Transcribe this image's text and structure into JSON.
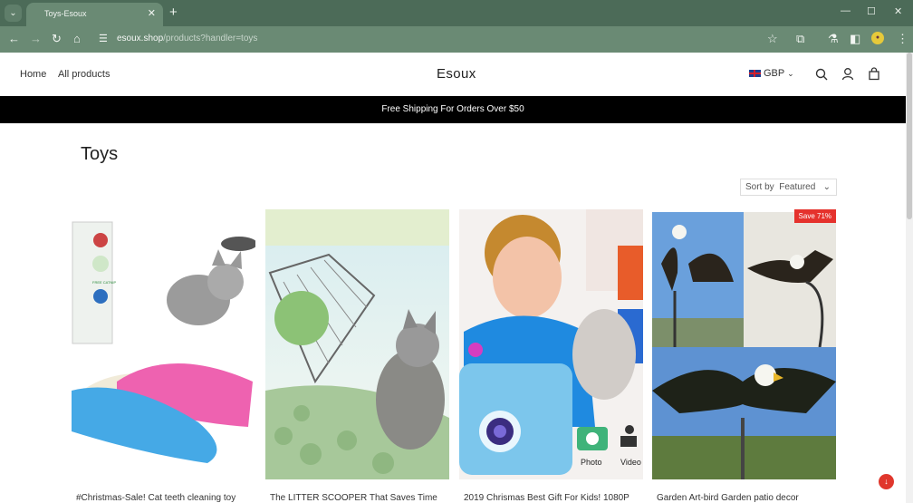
{
  "browser": {
    "tab_title": "Toys-Esoux",
    "url_host": "esoux.shop",
    "url_path": "/products?handler=toys"
  },
  "header": {
    "nav": [
      "Home",
      "All products"
    ],
    "logo": "Esoux",
    "currency": "GBP"
  },
  "announcement": "Free Shipping For Orders Over $50",
  "collection": {
    "title": "Toys",
    "sort_label": "Sort by",
    "sort_value": "Featured"
  },
  "products": [
    {
      "title": "#Christmas-Sale! Cat teeth cleaning toy"
    },
    {
      "title": "The LITTER SCOOPER That Saves Time"
    },
    {
      "title": "2019 Chrismas Best Gift For Kids! 1080P"
    },
    {
      "title": "Garden Art-bird Garden patio decor",
      "badge": "Save 71%"
    }
  ],
  "camera_card": {
    "photo_label": "Photo",
    "video_label": "Video"
  },
  "cat_package_text": "FREE CATNIP",
  "icons": [
    "tab-dropdown-icon",
    "new-tab-icon",
    "minimize-icon",
    "maximize-icon",
    "window-close-icon",
    "back-icon",
    "forward-icon",
    "reload-icon",
    "home-icon",
    "site-info-icon",
    "bookmark-star-icon",
    "extensions-icon",
    "labs-icon",
    "sidebar-icon",
    "profile-icon",
    "more-icon",
    "search-icon",
    "account-icon",
    "cart-icon",
    "chevron-down-icon",
    "chat-icon"
  ],
  "colors": {
    "chrome": "#4c6b58",
    "announcement_bg": "#000000",
    "badge": "#e5322d"
  }
}
